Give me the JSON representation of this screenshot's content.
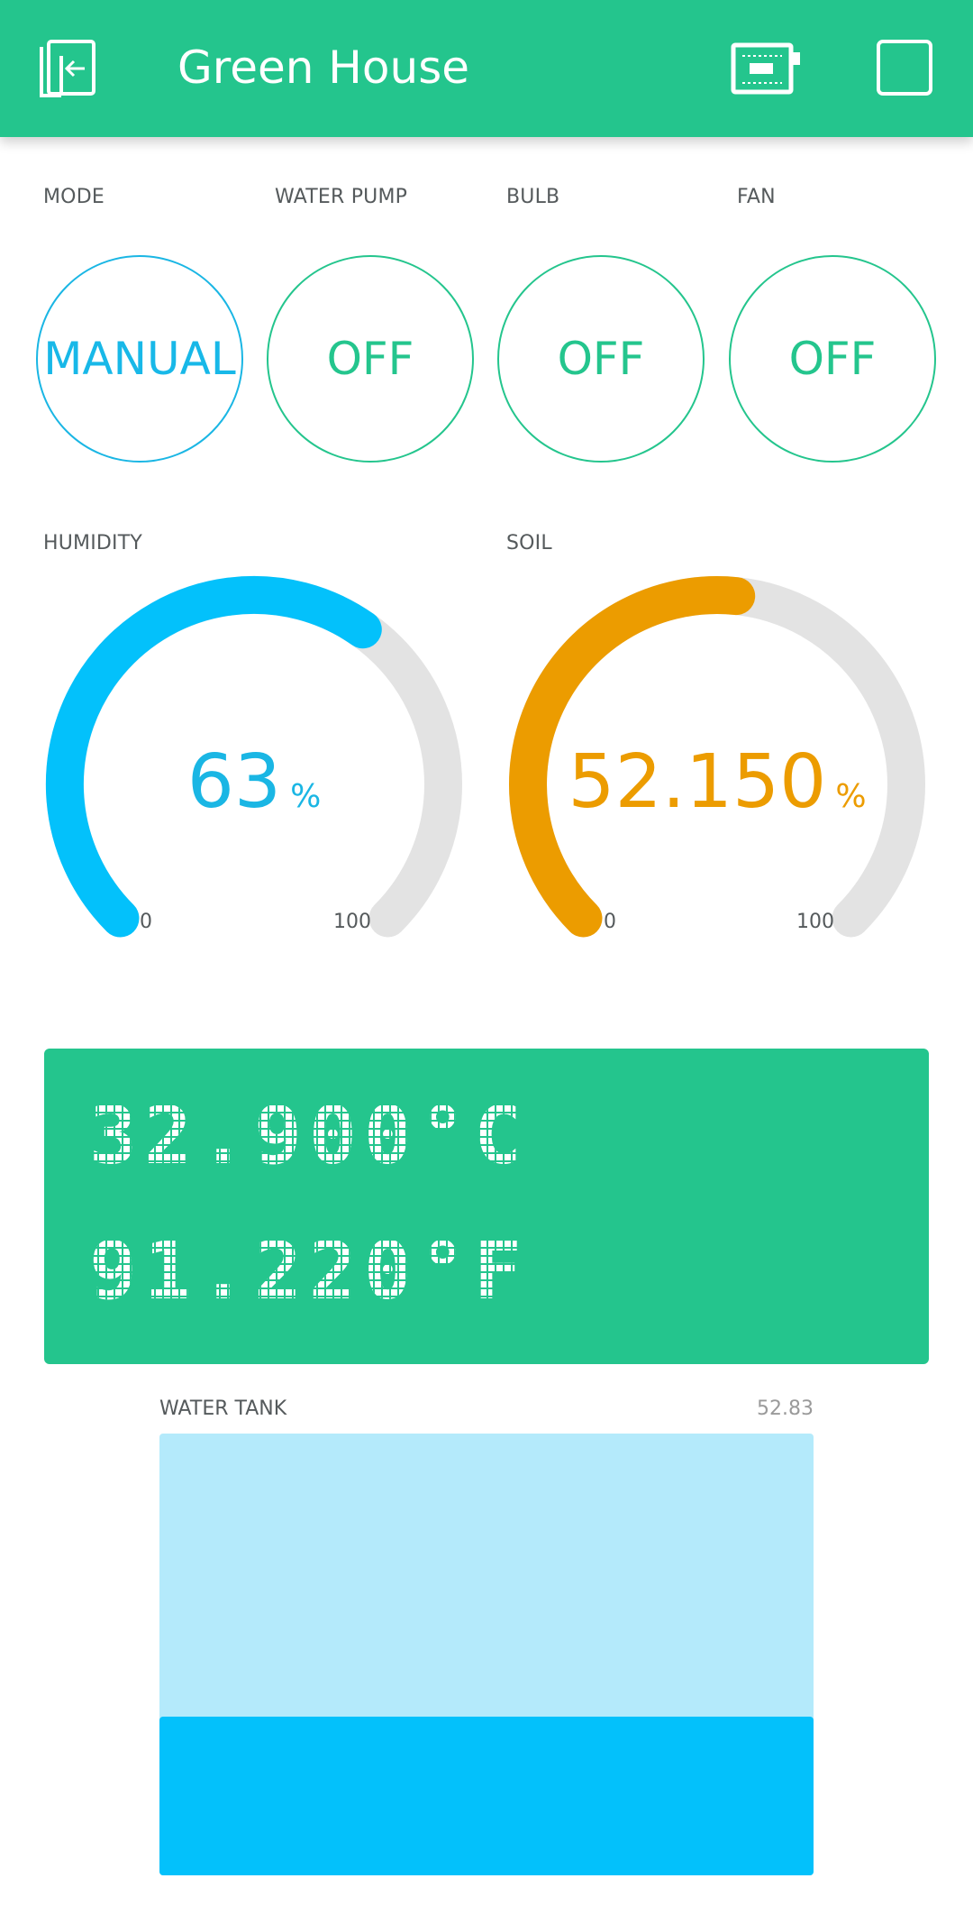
{
  "header": {
    "title": "Green House",
    "exit_icon": "exit-door-icon",
    "device_icon": "device-board-icon",
    "play_icon": "play-square-icon"
  },
  "controls": [
    {
      "id": "mode",
      "label": "MODE",
      "value": "MANUAL",
      "color": "#18b8e8"
    },
    {
      "id": "water-pump",
      "label": "WATER PUMP",
      "value": "OFF",
      "color": "#24c58d"
    },
    {
      "id": "bulb",
      "label": "BULB",
      "value": "OFF",
      "color": "#24c58d"
    },
    {
      "id": "fan",
      "label": "FAN",
      "value": "OFF",
      "color": "#24c58d"
    }
  ],
  "gauges": {
    "humidity": {
      "label": "HUMIDITY",
      "value": "63",
      "numeric": 63,
      "unit": "%",
      "min": "0",
      "max": "100",
      "color": "#03c1fb",
      "track": "#e3e3e3"
    },
    "soil": {
      "label": "SOIL",
      "value": "52.150",
      "numeric": 52.15,
      "unit": "%",
      "min": "0",
      "max": "100",
      "color": "#ec9c00",
      "track": "#e3e3e3"
    }
  },
  "lcd": {
    "line1": "32.900°C",
    "line2": "91.220°F",
    "background": "#24c58d"
  },
  "water_tank": {
    "label": "WATER TANK",
    "value": "52.83",
    "level_fraction": 0.3583,
    "empty_color": "#b4eafb",
    "fill_color": "#03c1fb"
  },
  "colors": {
    "accent": "#24c58d"
  }
}
